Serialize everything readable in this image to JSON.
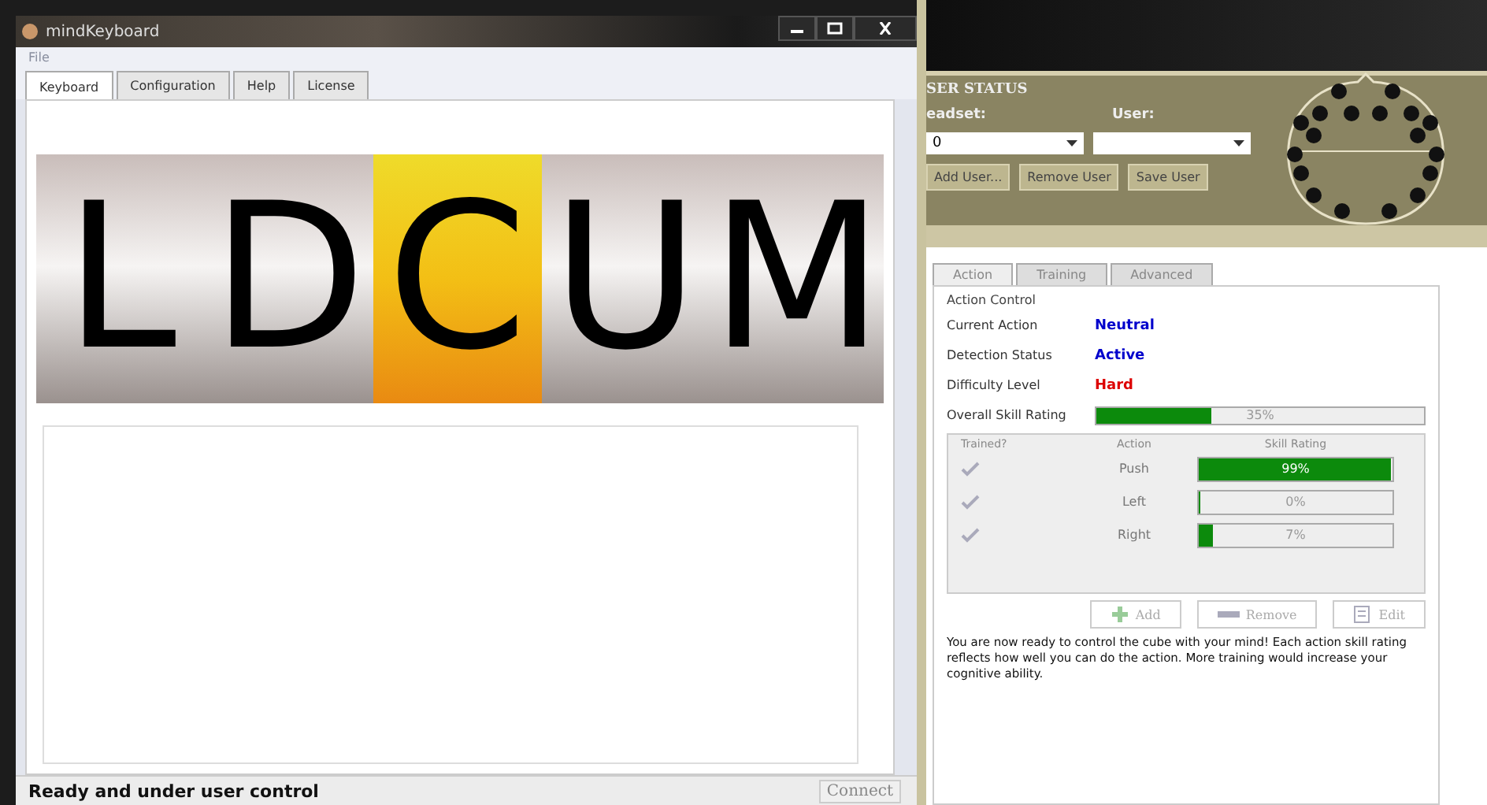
{
  "window": {
    "title": "mindKeyboard",
    "menu": [
      "File"
    ],
    "tabs": [
      {
        "label": "Keyboard",
        "selected": true
      },
      {
        "label": "Configuration",
        "selected": false
      },
      {
        "label": "Help",
        "selected": false
      },
      {
        "label": "License",
        "selected": false
      }
    ]
  },
  "keys": [
    {
      "label": "L",
      "selected": false
    },
    {
      "label": "D",
      "selected": false
    },
    {
      "label": "C",
      "selected": true
    },
    {
      "label": "U",
      "selected": false
    },
    {
      "label": "M",
      "selected": false
    }
  ],
  "status_bar": {
    "text": "Ready and under user control",
    "button": "Connect"
  },
  "user_status": {
    "title": "SER STATUS",
    "headset_label": "eadset:",
    "user_label": "User:",
    "headset_value": "0",
    "buttons": [
      "Add User...",
      "Remove User",
      "Save User"
    ]
  },
  "panel_tabs": [
    {
      "label": "Action",
      "selected": true
    },
    {
      "label": "Training",
      "selected": false
    },
    {
      "label": "Advanced",
      "selected": false
    }
  ],
  "action_control": {
    "title": "Action Control",
    "rows": [
      {
        "label": "Current Action",
        "value": "Neutral",
        "color": "#0000cc"
      },
      {
        "label": "Detection Status",
        "value": "Active",
        "color": "#0000cc"
      },
      {
        "label": "Difficulty Level",
        "value": "Hard",
        "color": "#dd0000"
      }
    ],
    "overall": {
      "label": "Overall Skill Rating",
      "level": 0.35,
      "reading": "35%"
    }
  },
  "table": {
    "columns": [
      "Trained?",
      "Action",
      "Skill Rating"
    ],
    "rows": [
      {
        "checked": true,
        "action": "Push",
        "level": 0.99,
        "reading": "99%"
      },
      {
        "checked": true,
        "action": "Left",
        "level": 0.01,
        "reading": "0%"
      },
      {
        "checked": true,
        "action": "Right",
        "level": 0.07,
        "reading": "7%"
      }
    ]
  },
  "table_buttons": [
    {
      "label": "Add",
      "kind": "add",
      "disabled": true
    },
    {
      "label": "Remove",
      "kind": "remove",
      "disabled": true
    },
    {
      "label": "Edit",
      "kind": "edit",
      "disabled": true
    }
  ],
  "message": "You are now ready to control the cube with your mind! Each action skill rating reflects how well you can do the action. More training would increase your cognitive ability."
}
